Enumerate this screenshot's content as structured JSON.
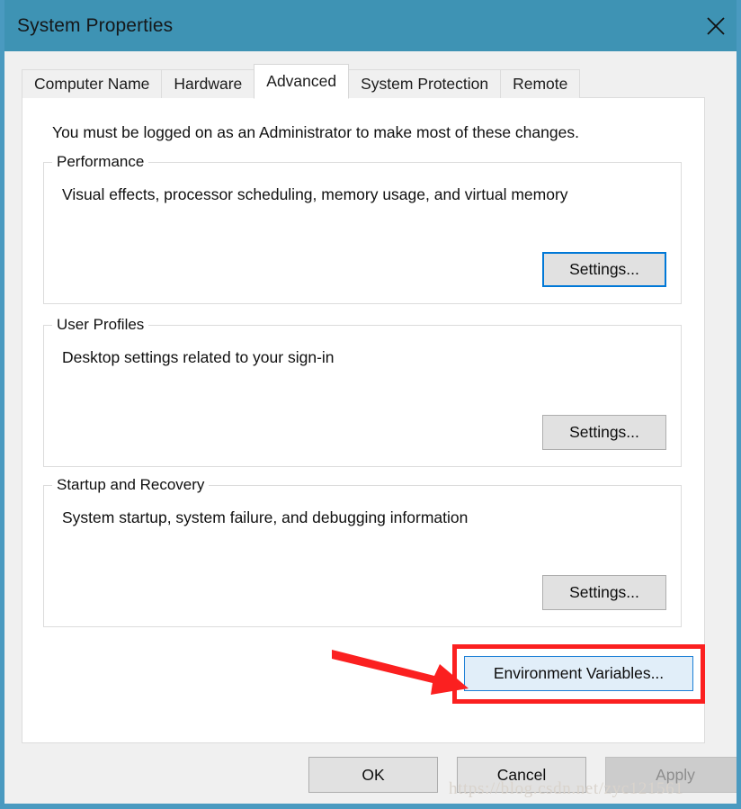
{
  "window": {
    "title": "System Properties",
    "close_icon": "close-icon",
    "titlebar_color": "#3e93b4",
    "border_color": "#4a9ac0"
  },
  "tabs": [
    {
      "label": "Computer Name",
      "active": false
    },
    {
      "label": "Hardware",
      "active": false
    },
    {
      "label": "Advanced",
      "active": true
    },
    {
      "label": "System Protection",
      "active": false
    },
    {
      "label": "Remote",
      "active": false
    }
  ],
  "page": {
    "admin_note": "You must be logged on as an Administrator to make most of these changes.",
    "groups": [
      {
        "legend": "Performance",
        "description": "Visual effects, processor scheduling, memory usage, and virtual memory",
        "button_label": "Settings...",
        "button_state": "focused"
      },
      {
        "legend": "User Profiles",
        "description": "Desktop settings related to your sign-in",
        "button_label": "Settings...",
        "button_state": "normal"
      },
      {
        "legend": "Startup and Recovery",
        "description": "System startup, system failure, and debugging information",
        "button_label": "Settings...",
        "button_state": "normal"
      }
    ],
    "env_button": {
      "label": "Environment Variables...",
      "state": "hovered"
    }
  },
  "annotation": {
    "color": "#fb2020",
    "shape": "rectangle-with-arrow",
    "target": "Environment Variables..."
  },
  "footer": {
    "ok_label": "OK",
    "cancel_label": "Cancel",
    "apply_label": "Apply",
    "apply_state": "disabled"
  },
  "watermark": {
    "text": "https://blog.csdn.net/zyc121561"
  }
}
